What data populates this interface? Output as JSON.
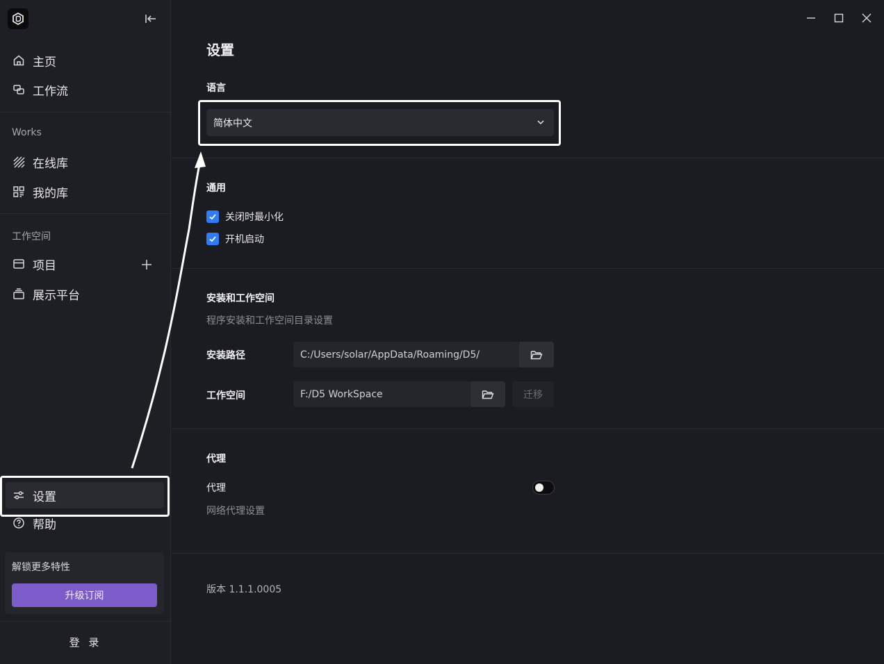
{
  "sidebar": {
    "nav_top": [
      {
        "label": "主页",
        "icon": "home-icon"
      },
      {
        "label": "工作流",
        "icon": "workflow-icon"
      }
    ],
    "works_section": {
      "label": "Works",
      "items": [
        {
          "label": "在线库",
          "icon": "online-library-icon"
        },
        {
          "label": "我的库",
          "icon": "my-library-icon"
        }
      ]
    },
    "workspace_section": {
      "label": "工作空间",
      "items": [
        {
          "label": "项目",
          "icon": "project-icon"
        },
        {
          "label": "展示平台",
          "icon": "showcase-icon"
        }
      ]
    },
    "bottom": [
      {
        "label": "设置",
        "icon": "settings-sliders-icon",
        "active": true
      },
      {
        "label": "帮助",
        "icon": "help-icon"
      }
    ],
    "unlock_card": {
      "title": "解锁更多特性",
      "button": "升级订阅"
    },
    "login_label": "登 录"
  },
  "main": {
    "title": "设置",
    "language": {
      "heading": "语言",
      "selected": "简体中文"
    },
    "general": {
      "heading": "通用",
      "options": [
        {
          "label": "关闭时最小化",
          "checked": true
        },
        {
          "label": "开机启动",
          "checked": true
        }
      ]
    },
    "install": {
      "heading": "安装和工作空间",
      "description": "程序安装和工作空间目录设置",
      "install_path_label": "安装路径",
      "install_path_value": "C:/Users/solar/AppData/Roaming/D5/",
      "workspace_label": "工作空间",
      "workspace_value": "F:/D5 WorkSpace",
      "migrate_label": "迁移"
    },
    "proxy": {
      "heading": "代理",
      "label": "代理",
      "description": "网络代理设置",
      "enabled": false
    },
    "version": "版本 1.1.1.0005"
  },
  "colors": {
    "background": "#1b1c21",
    "sidebar": "#1e1f24",
    "accent_blue": "#2f7cf6",
    "upgrade_purple": "#7b5cc8",
    "highlight": "#ffffff"
  }
}
